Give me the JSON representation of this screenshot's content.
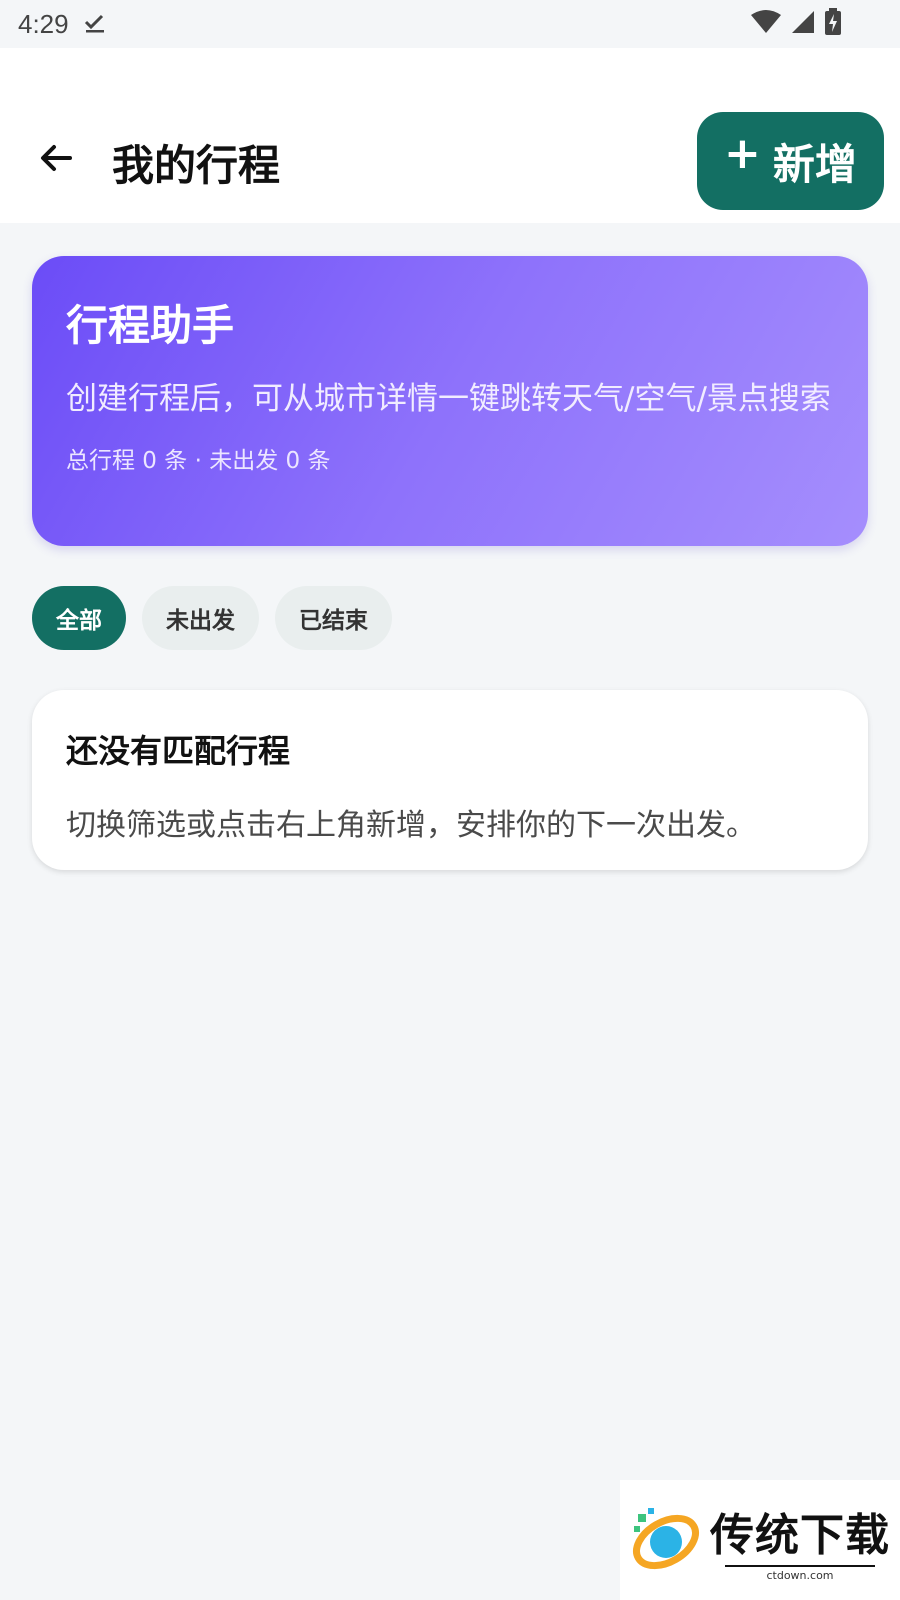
{
  "status_bar": {
    "time": "4:29",
    "icons": [
      "download-done-icon",
      "wifi-icon",
      "cell-signal-icon",
      "battery-charging-icon"
    ]
  },
  "app_bar": {
    "title": "我的行程",
    "add_button_label": "新增",
    "accent_color": "#136f63"
  },
  "hero_card": {
    "title": "行程助手",
    "description": "创建行程后，可从城市详情一键跳转天气/空气/景点搜索",
    "stats": "总行程 0 条 · 未出发 0 条",
    "gradient_colors": [
      "#6b4cf7",
      "#a58efd"
    ]
  },
  "filters": [
    {
      "label": "全部",
      "active": true
    },
    {
      "label": "未出发",
      "active": false
    },
    {
      "label": "已结束",
      "active": false
    }
  ],
  "empty_state": {
    "title": "还没有匹配行程",
    "description": "切换筛选或点击右上角新增，安排你的下一次出发。"
  },
  "watermark": {
    "name": "传统下载",
    "url": "ctdown.com"
  }
}
